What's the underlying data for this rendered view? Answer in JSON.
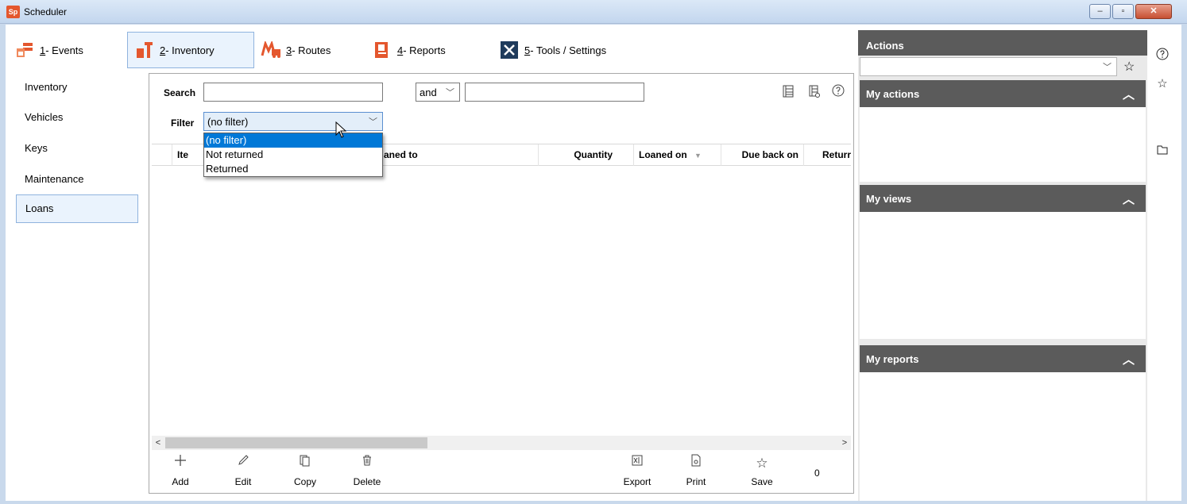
{
  "window": {
    "title": "Scheduler",
    "app_icon": "Sp",
    "buttons": {
      "minimize": "‒",
      "maximize": "▫",
      "close": "✕"
    }
  },
  "tabs": [
    {
      "key": "1",
      "label": "- Events",
      "icon": "events-icon"
    },
    {
      "key": "2",
      "label": "- Inventory",
      "icon": "inventory-icon"
    },
    {
      "key": "3",
      "label": "- Routes",
      "icon": "routes-icon"
    },
    {
      "key": "4",
      "label": "- Reports",
      "icon": "reports-icon"
    },
    {
      "key": "5",
      "label": "- Tools / Settings",
      "icon": "tools-icon"
    }
  ],
  "nav": [
    {
      "label": "Inventory"
    },
    {
      "label": "Vehicles"
    },
    {
      "label": "Keys"
    },
    {
      "label": "Maintenance"
    },
    {
      "label": "Loans",
      "selected": true
    }
  ],
  "search": {
    "label": "Search",
    "value": "",
    "operator": "and",
    "value2": ""
  },
  "filter": {
    "label": "Filter",
    "value": "(no filter)",
    "options": [
      "(no filter)",
      "Not returned",
      "Returned"
    ],
    "highlighted": "(no filter)"
  },
  "grid": {
    "columns": [
      "Ite",
      "aned to",
      "Quantity",
      "Loaned on",
      "Due back on",
      "Returr"
    ],
    "rows": []
  },
  "toolbar": {
    "add": "Add",
    "edit": "Edit",
    "copy": "Copy",
    "delete": "Delete",
    "export": "Export",
    "print": "Print",
    "save": "Save",
    "count": "0"
  },
  "actions_panel": {
    "title": "Actions",
    "combo_value": "",
    "sections": [
      {
        "title": "My actions"
      },
      {
        "title": "My views"
      },
      {
        "title": "My reports"
      }
    ]
  },
  "colors": {
    "selection_blue": "#0078d7",
    "section_header": "#5b5b5b",
    "tab_highlight": "#eaf3fd",
    "tab_border": "#8fb3de"
  }
}
